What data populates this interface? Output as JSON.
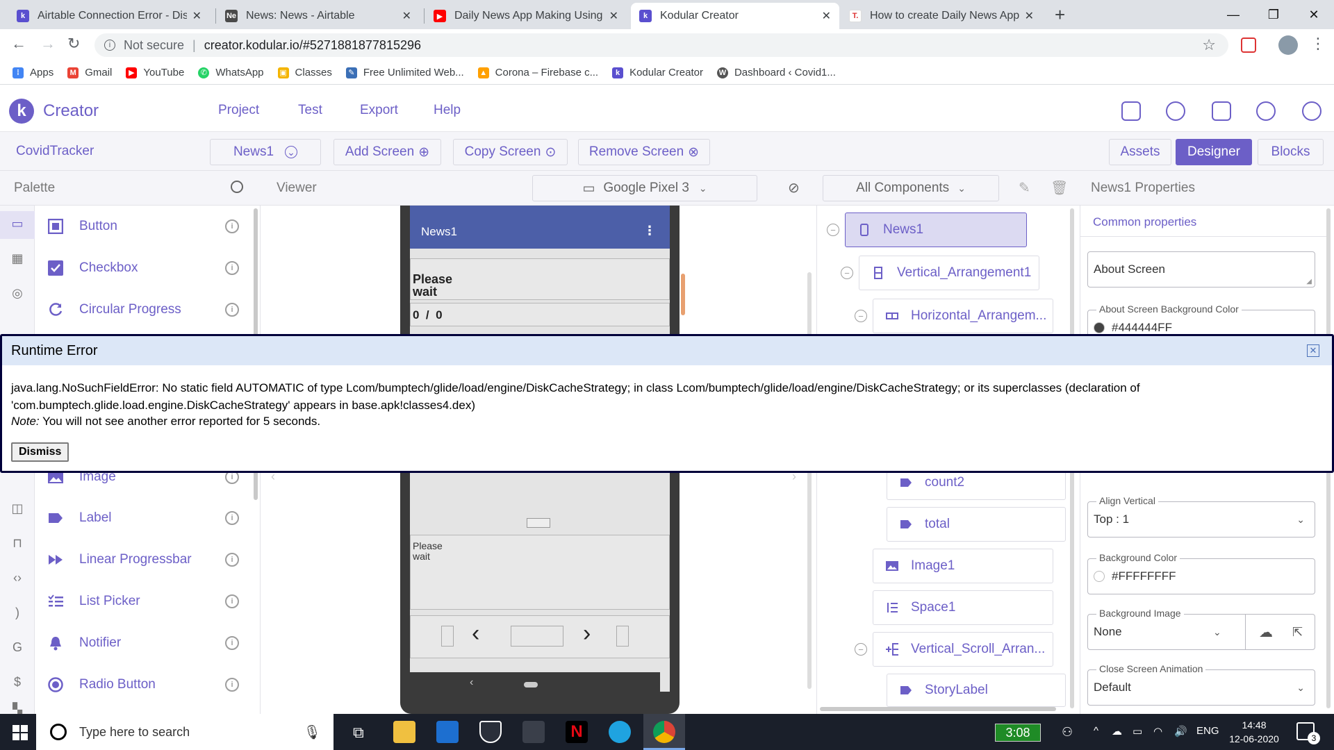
{
  "browser": {
    "tabs": [
      {
        "title": "Airtable Connection Error - Discu",
        "favicon": "K",
        "color": "#5a4fcf",
        "active": false
      },
      {
        "title": "News: News - Airtable",
        "favicon": "Ne",
        "color": "#4a4a4a",
        "active": false
      },
      {
        "title": "Daily News App Making Using Ko",
        "favicon": "youtube-icon",
        "color": "#ff0000",
        "active": false
      },
      {
        "title": "Kodular Creator",
        "favicon": "K",
        "color": "#5a4fcf",
        "active": true
      },
      {
        "title": "How to create Daily News App w",
        "favicon": "T.",
        "color": "#d33",
        "active": false
      }
    ],
    "security": "Not secure",
    "url": "creator.kodular.io/#5271881877815296",
    "bookmarks": [
      {
        "label": "Apps",
        "color": "#4285f4"
      },
      {
        "label": "Gmail",
        "color": "#ea4335"
      },
      {
        "label": "YouTube",
        "color": "#ff0000"
      },
      {
        "label": "WhatsApp",
        "color": "#25d366"
      },
      {
        "label": "Classes",
        "color": "#f4b400"
      },
      {
        "label": "Free Unlimited Web...",
        "color": "#3b6fb6"
      },
      {
        "label": "Corona – Firebase c...",
        "color": "#ffa000"
      },
      {
        "label": "Kodular Creator",
        "color": "#5a4fcf"
      },
      {
        "label": "Dashboard ‹ Covid1...",
        "color": "#555"
      }
    ]
  },
  "app": {
    "brand": "Creator",
    "menu": [
      "Project",
      "Test",
      "Export",
      "Help"
    ],
    "project_name": "CovidTracker",
    "screen_select": "News1",
    "add_screen": "Add Screen",
    "copy_screen": "Copy Screen",
    "remove_screen": "Remove Screen",
    "assets": "Assets",
    "designer": "Designer",
    "blocks": "Blocks",
    "palette_title": "Palette",
    "viewer_title": "Viewer",
    "device": "Google Pixel 3",
    "components_filter": "All Components",
    "properties_title": "News1 Properties",
    "accent": "#6c5fc7"
  },
  "palette": {
    "items": [
      "Button",
      "Checkbox",
      "Circular Progress",
      "Image",
      "Label",
      "Linear Progressbar",
      "List Picker",
      "Notifier",
      "Radio Button"
    ]
  },
  "phone": {
    "title": "News1",
    "please_wait": "Please wait",
    "counter": "0  /  0",
    "please_wait_small": "Please wait"
  },
  "tree": {
    "items": [
      "News1",
      "Vertical_Arrangement1",
      "Horizontal_Arrangem...",
      "count2",
      "total",
      "Image1",
      "Space1",
      "Vertical_Scroll_Arran...",
      "StoryLabel"
    ]
  },
  "properties": {
    "section": "Common properties",
    "about_screen": "About Screen",
    "about_bg_label": "About Screen Background Color",
    "about_bg_value": "#444444FF",
    "align_vertical_label": "Align Vertical",
    "align_vertical_value": "Top : 1",
    "bg_color_label": "Background Color",
    "bg_color_value": "#FFFFFFFF",
    "bg_image_label": "Background Image",
    "bg_image_value": "None",
    "close_anim_label": "Close Screen Animation",
    "close_anim_value": "Default"
  },
  "error": {
    "title": "Runtime Error",
    "message": "java.lang.NoSuchFieldError: No static field AUTOMATIC of type Lcom/bumptech/glide/load/engine/DiskCacheStrategy; in class Lcom/bumptech/glide/load/engine/DiskCacheStrategy; or its superclasses (declaration of 'com.bumptech.glide.load.engine.DiskCacheStrategy' appears in base.apk!classes4.dex)",
    "note_label": "Note:",
    "note_text": "You will not see another error reported for 5 seconds.",
    "dismiss": "Dismiss"
  },
  "taskbar": {
    "search_placeholder": "Type here to search",
    "battery_time": "3:08",
    "language": "ENG",
    "time": "14:48",
    "date": "12-06-2020",
    "notifications": "3"
  }
}
